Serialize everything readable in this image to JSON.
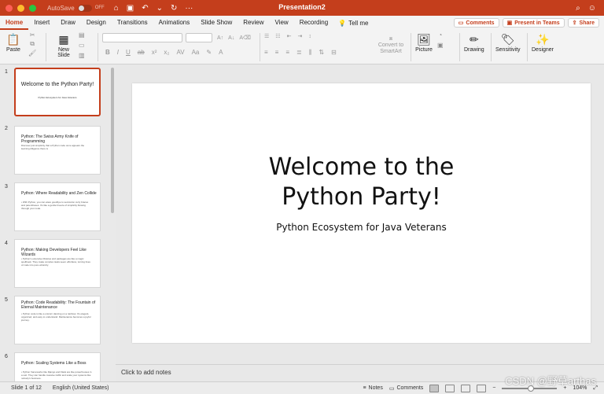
{
  "titlebar": {
    "autosave_label": "AutoSave",
    "autosave_state": "OFF",
    "document_title": "Presentation2"
  },
  "tabs": [
    "Home",
    "Insert",
    "Draw",
    "Design",
    "Transitions",
    "Animations",
    "Slide Show",
    "Review",
    "View",
    "Recording"
  ],
  "tell_me": "Tell me",
  "top_right": {
    "comments": "Comments",
    "present_in_teams": "Present in Teams",
    "share": "Share"
  },
  "ribbon": {
    "paste": "Paste",
    "new_slide": "New Slide",
    "convert_smartart": "Convert to SmartArt",
    "picture": "Picture",
    "drawing": "Drawing",
    "sensitivity": "Sensitivity",
    "designer": "Designer"
  },
  "slides": [
    {
      "num": "1",
      "title": "Welcome to the Python Party!",
      "subtitle": "Python Ecosystem for Java Veterans"
    },
    {
      "num": "2",
      "title": "Python: The Swiss Army Knife of Programming",
      "body": "Discover just simplicity that a Python code once appears the learning diligence there is"
    },
    {
      "num": "3",
      "title": "Python: Where Readability and Zen Collide",
      "body": "• With Python, you can wave goodbye to semicolon curly braces and parentheses. It's like a gentle breeze of simplicity blowing through your code."
    },
    {
      "num": "4",
      "title": "Python: Making Developers Feel Like Wizards",
      "body": "• Python's extensive libraries and packages are like a magic spellbook. They make complex tasks seem effortless, turning lines of code into pure wizardry."
    },
    {
      "num": "5",
      "title": "Python: Code Readability: The Fountain of Eternal Maintenance",
      "body": "• Python code is like a unicorn dancing on a rainbow. It's elegant, organized, and easy to understand. Maintenance becomes a joyful journey."
    },
    {
      "num": "6",
      "title": "Python: Scaling Systems Like a Boss",
      "body": "• Python frameworks like Django and Flask are like powerhouses in a suit. They can handle massive traffic and scale your systems like nobody's business."
    }
  ],
  "main_slide": {
    "title": "Welcome to the Python Party!",
    "subtitle": "Python Ecosystem for Java Veterans"
  },
  "notes_placeholder": "Click to add notes",
  "status": {
    "slide_of": "Slide 1 of 12",
    "language": "English (United States)",
    "notes": "Notes",
    "comments": "Comments",
    "zoom": "104%",
    "zoom_fraction": 0.52
  },
  "watermark": "CSDN @野草arthas",
  "colors": {
    "accent": "#c43e1c"
  }
}
